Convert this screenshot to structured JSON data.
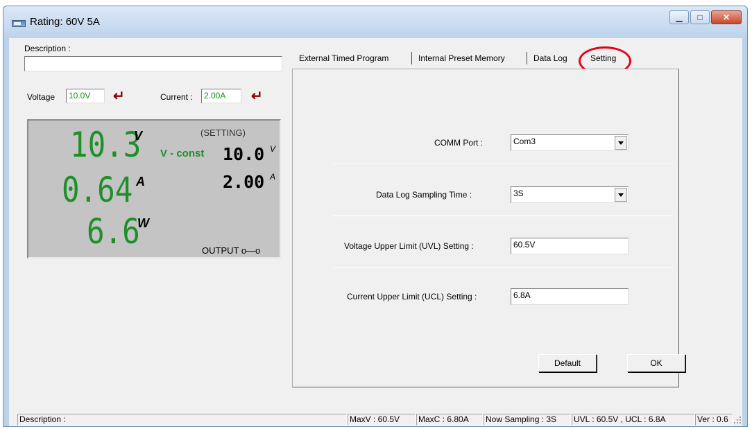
{
  "window": {
    "title": "Rating: 60V 5A"
  },
  "left": {
    "description_label": "Description :",
    "description_value": "",
    "voltage_label": "Voltage",
    "voltage_value": "10.0V",
    "current_label": "Current :",
    "current_value": "2.00A",
    "enter_icon": "enter-arrow-icon"
  },
  "display": {
    "measured_voltage": "10.3",
    "measured_voltage_unit": "V",
    "measured_current": "0.64",
    "measured_current_unit": "A",
    "measured_power": "6.6",
    "measured_power_unit": "W",
    "setting_label": "(SETTING)",
    "mode": "V - const",
    "set_voltage": "10.0",
    "set_voltage_unit": "V",
    "set_current": "2.00",
    "set_current_unit": "A",
    "output_label": "OUTPUT o—o"
  },
  "tabs": [
    {
      "label": "External Timed Program"
    },
    {
      "label": "Internal Preset Memory"
    },
    {
      "label": "Data Log"
    },
    {
      "label": "Setting",
      "active": true
    }
  ],
  "setting": {
    "comm_port_label": "COMM Port :",
    "comm_port_value": "Com3",
    "sampling_label": "Data Log Sampling Time :",
    "sampling_value": "3S",
    "uvl_label": "Voltage Upper Limit (UVL) Setting :",
    "uvl_value": "60.5V",
    "ucl_label": "Current Upper Limit (UCL) Setting :",
    "ucl_value": "6.8A",
    "default_button": "Default",
    "ok_button": "OK"
  },
  "status": {
    "description": "Description :",
    "maxv": "MaxV : 60.5V",
    "maxc": "MaxC : 6.80A",
    "sampling": "Now Sampling : 3S",
    "limits": "UVL : 60.5V , UCL : 6.8A",
    "version": "Ver : 0.6"
  },
  "colors": {
    "highlight_circle": "#e8001a",
    "lcd_green": "#1f8f2a",
    "enter_arrow": "#8b0000"
  }
}
